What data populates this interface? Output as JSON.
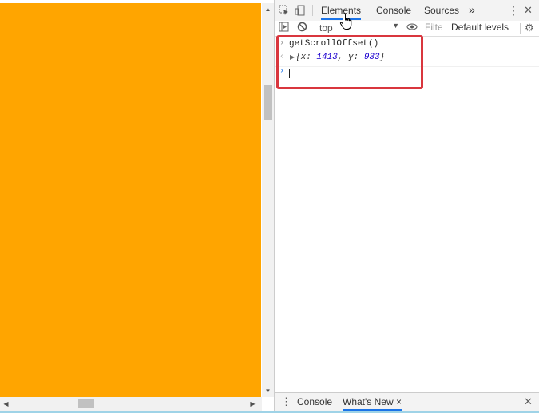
{
  "devtools": {
    "tabs": [
      {
        "label": "Elements",
        "active": true
      },
      {
        "label": "Console",
        "active": false
      },
      {
        "label": "Sources",
        "active": false
      }
    ],
    "more_tabs": "»",
    "menu": "⋮",
    "close": "✕"
  },
  "console_toolbar": {
    "context": "top",
    "filter_placeholder": "Filter",
    "levels": "Default levels"
  },
  "console": {
    "input_command": "getScrollOffset()",
    "result_prefix": "{x: ",
    "result_x": "1413",
    "result_mid": ", y: ",
    "result_y": "933",
    "result_suffix": "}"
  },
  "drawer": {
    "tabs": [
      {
        "label": "Console",
        "active": false
      },
      {
        "label": "What's New",
        "active": true
      }
    ],
    "tab_close": "×",
    "close": "✕"
  },
  "colors": {
    "page_background": "#ffa500",
    "highlight_border": "#d9363e",
    "active_tab": "#1a73e8"
  }
}
